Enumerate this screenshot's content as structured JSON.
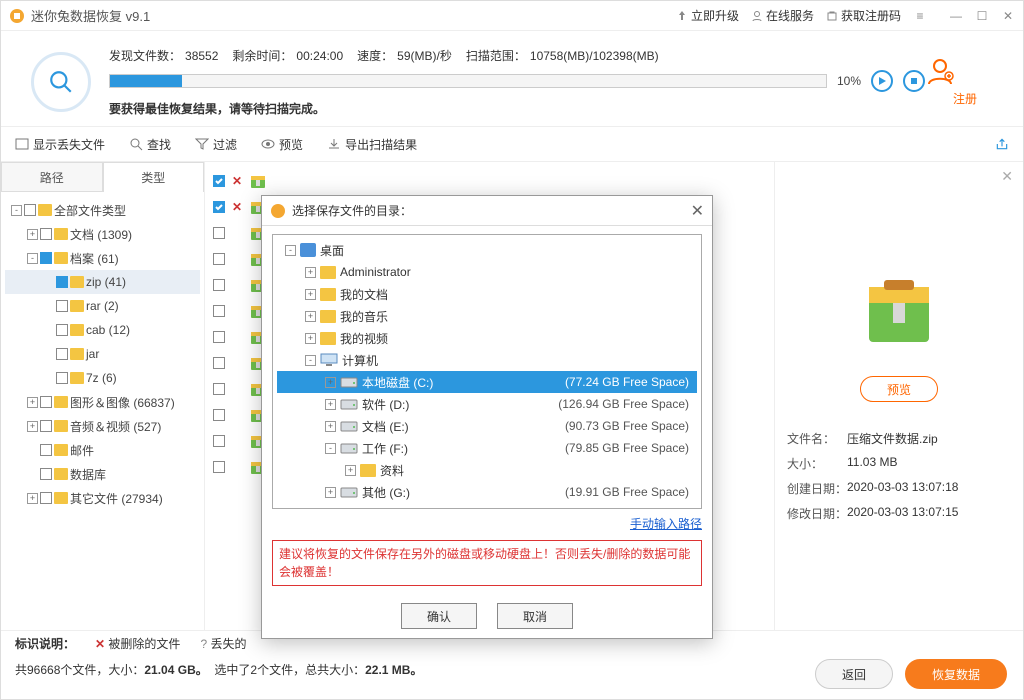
{
  "app": {
    "title": "迷你兔数据恢复  v9.1"
  },
  "titlebar_links": {
    "upgrade": "立即升级",
    "online": "在线服务",
    "regcode": "获取注册码"
  },
  "scan": {
    "found_label": "发现文件数：",
    "found": "38552",
    "remain_label": "剩余时间：",
    "remain": "00:24:00",
    "speed_label": "速度：",
    "speed": "59(MB)/秒",
    "range_label": "扫描范围：",
    "range": "10758(MB)/102398(MB)",
    "pct": "10%",
    "msg": "要获得最佳恢复结果，请等待扫描完成。"
  },
  "register": {
    "label": "注册"
  },
  "toolbar": {
    "showlost": "显示丢失文件",
    "find": "查找",
    "filter": "过滤",
    "preview": "预览",
    "export": "导出扫描结果"
  },
  "tabs": {
    "path": "路径",
    "type": "类型"
  },
  "tree": [
    {
      "ind": 0,
      "exp": "-",
      "chk": 0,
      "label": "全部文件类型"
    },
    {
      "ind": 1,
      "exp": "+",
      "chk": 0,
      "label": "文档 (1309)"
    },
    {
      "ind": 1,
      "exp": "-",
      "chk": 1,
      "label": "档案 (61)"
    },
    {
      "ind": 2,
      "exp": "",
      "chk": 1,
      "label": "zip (41)",
      "sel": true
    },
    {
      "ind": 2,
      "exp": "",
      "chk": 0,
      "label": "rar (2)"
    },
    {
      "ind": 2,
      "exp": "",
      "chk": 0,
      "label": "cab (12)"
    },
    {
      "ind": 2,
      "exp": "",
      "chk": 0,
      "label": "jar"
    },
    {
      "ind": 2,
      "exp": "",
      "chk": 0,
      "label": "7z (6)"
    },
    {
      "ind": 1,
      "exp": "+",
      "chk": 0,
      "label": "图形＆图像 (66837)"
    },
    {
      "ind": 1,
      "exp": "+",
      "chk": 0,
      "label": "音频＆视频 (527)"
    },
    {
      "ind": 1,
      "exp": "",
      "chk": 0,
      "label": "邮件"
    },
    {
      "ind": 1,
      "exp": "",
      "chk": 0,
      "label": "数据库"
    },
    {
      "ind": 1,
      "exp": "+",
      "chk": 0,
      "label": "其它文件 (27934)"
    }
  ],
  "files": [
    {
      "chk": true,
      "x": true
    },
    {
      "chk": true,
      "x": true
    },
    {
      "chk": false,
      "x": false
    },
    {
      "chk": false,
      "x": false
    },
    {
      "chk": false,
      "x": false
    },
    {
      "chk": false,
      "x": false
    },
    {
      "chk": false,
      "x": false
    },
    {
      "chk": false,
      "x": false
    },
    {
      "chk": false,
      "x": false
    },
    {
      "chk": false,
      "x": false
    },
    {
      "chk": false,
      "x": false
    },
    {
      "chk": false,
      "x": false
    }
  ],
  "preview": {
    "btn": "预览",
    "name_label": "文件名：",
    "name": "压缩文件数据.zip",
    "size_label": "大小：",
    "size": "11.03 MB",
    "created_label": "创建日期：",
    "created": "2020-03-03 13:07:18",
    "modified_label": "修改日期：",
    "modified": "2020-03-03 13:07:15"
  },
  "legend": {
    "title": "标识说明：",
    "deleted": "被删除的文件",
    "lost": "丢失的"
  },
  "status": {
    "text_a": "共96668个文件，大小：",
    "size_a": "21.04 GB。",
    "text_b": "选中了2个文件，总共大小：",
    "size_b": "22.1 MB。"
  },
  "footer": {
    "back": "返回",
    "recover": "恢复数据"
  },
  "modal": {
    "title": "选择保存文件的目录：",
    "rows": [
      {
        "ind": 0,
        "exp": "-",
        "icon": "desk",
        "label": "桌面"
      },
      {
        "ind": 1,
        "exp": "+",
        "icon": "folder",
        "label": "Administrator"
      },
      {
        "ind": 1,
        "exp": "+",
        "icon": "folder",
        "label": "我的文档"
      },
      {
        "ind": 1,
        "exp": "+",
        "icon": "folder",
        "label": "我的音乐"
      },
      {
        "ind": 1,
        "exp": "+",
        "icon": "folder",
        "label": "我的视频"
      },
      {
        "ind": 1,
        "exp": "-",
        "icon": "pc",
        "label": "计算机"
      },
      {
        "ind": 2,
        "exp": "+",
        "icon": "disk",
        "label": "本地磁盘 (C:)",
        "extra": "(77.24 GB Free Space)",
        "sel": true
      },
      {
        "ind": 2,
        "exp": "+",
        "icon": "disk",
        "label": "软件 (D:)",
        "extra": "(126.94 GB Free Space)"
      },
      {
        "ind": 2,
        "exp": "+",
        "icon": "disk",
        "label": "文档 (E:)",
        "extra": "(90.73 GB Free Space)"
      },
      {
        "ind": 2,
        "exp": "-",
        "icon": "disk",
        "label": "工作 (F:)",
        "extra": "(79.85 GB Free Space)"
      },
      {
        "ind": 3,
        "exp": "+",
        "icon": "folder",
        "label": "资料"
      },
      {
        "ind": 2,
        "exp": "+",
        "icon": "disk",
        "label": "其他 (G:)",
        "extra": "(19.91 GB Free Space)"
      }
    ],
    "manual": "手动输入路径",
    "warn": "建议将恢复的文件保存在另外的磁盘或移动硬盘上！否则丢失/删除的数据可能会被覆盖！",
    "ok": "确认",
    "cancel": "取消"
  }
}
